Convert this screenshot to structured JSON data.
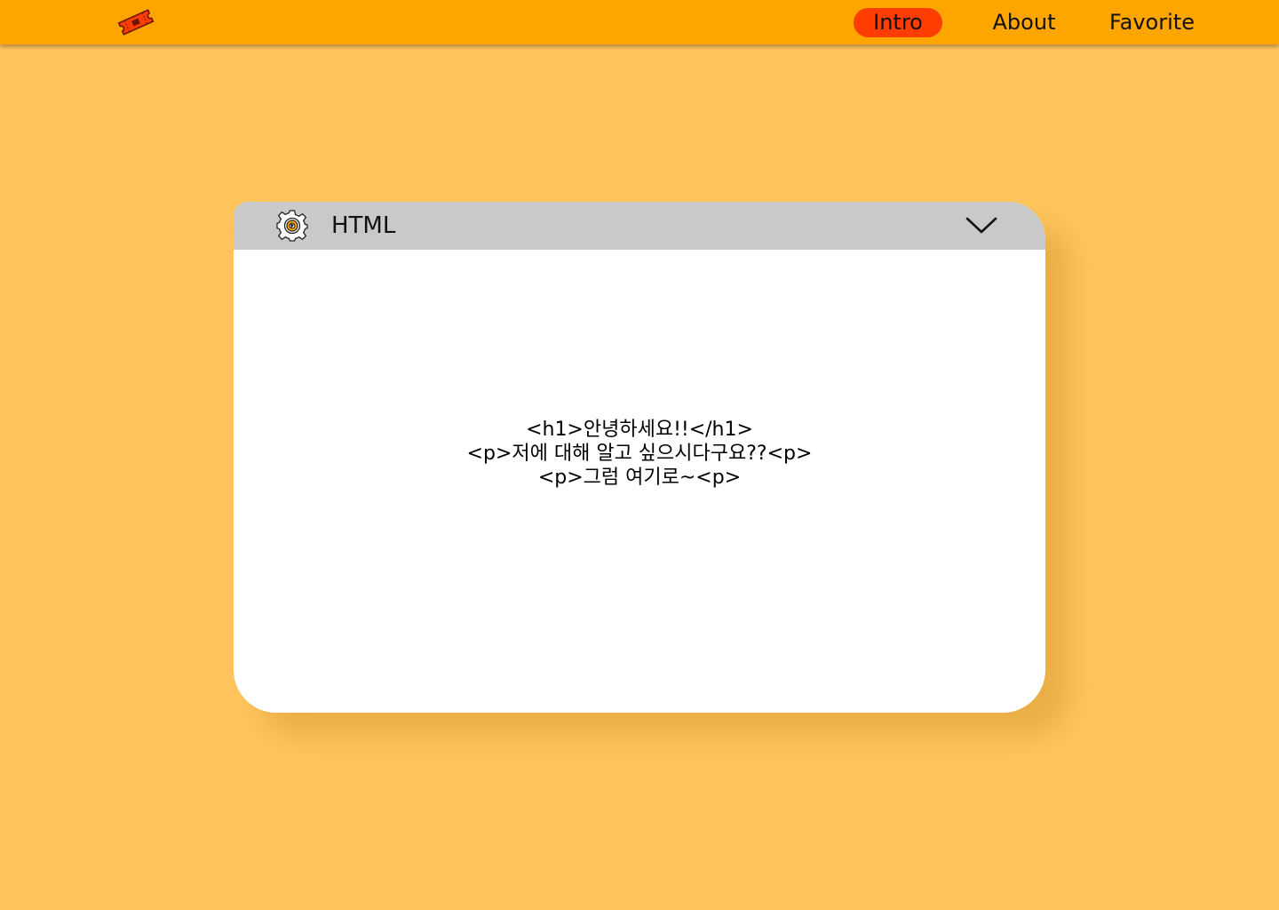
{
  "nav": {
    "logo_icon": "ticket-icon",
    "links": [
      {
        "label": "Intro",
        "active": true
      },
      {
        "label": "About",
        "active": false
      },
      {
        "label": "Favorite",
        "active": false
      }
    ]
  },
  "window": {
    "icon": "gear-icon",
    "title": "HTML",
    "collapse_icon": "chevron-down-icon",
    "lines": [
      "<h1>안녕하세요!!</h1>",
      "<p>저에 대해 알고 싶으시다구요??<p>",
      "<p>그럼 여기로~<p>"
    ]
  },
  "colors": {
    "background": "#ffc55c",
    "navbar": "#ffa500",
    "active_pill": "#ff3d00",
    "titlebar": "#c9c9c9",
    "window": "#ffffff"
  }
}
